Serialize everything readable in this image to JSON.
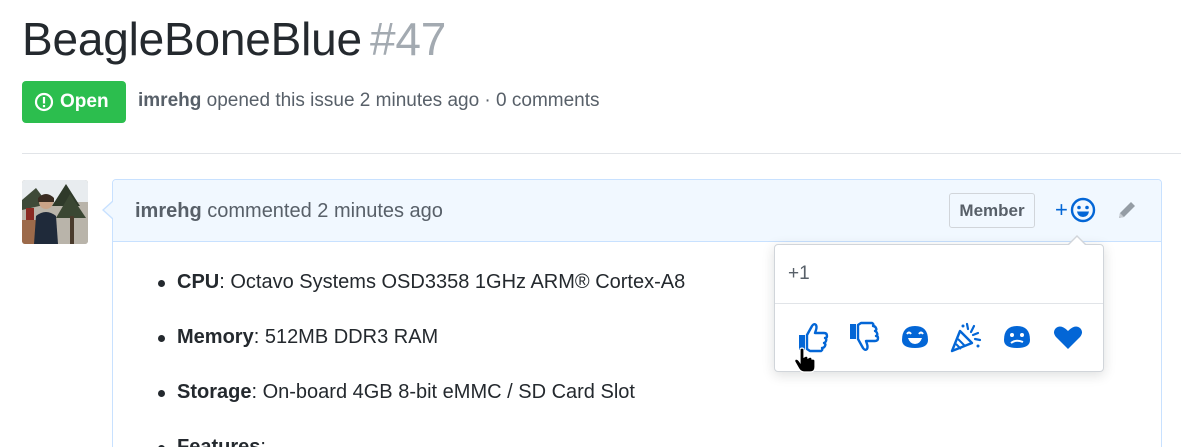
{
  "issue": {
    "title": "BeagleBoneBlue",
    "number": "#47",
    "state": "Open",
    "author": "imrehg",
    "meta_text": " opened this issue 2 minutes ago · 0 comments"
  },
  "comment": {
    "author": "imrehg",
    "meta_text": " commented 2 minutes ago",
    "role_badge": "Member",
    "add_reaction_plus": "+",
    "items": [
      {
        "label": "CPU",
        "text": ": Octavo Systems OSD3358 1GHz ARM® Cortex-A8"
      },
      {
        "label": "Memory",
        "text": ": 512MB DDR3 RAM"
      },
      {
        "label": "Storage",
        "text": ": On-board 4GB 8-bit eMMC / SD Card Slot"
      },
      {
        "label": "Features",
        "text": ":"
      }
    ]
  },
  "reaction_popover": {
    "hover_label": "+1",
    "reactions": [
      "thumbs-up",
      "thumbs-down",
      "laugh",
      "hooray",
      "confused",
      "heart"
    ]
  },
  "colors": {
    "open_green": "#2cbe4e",
    "link_blue": "#0366d6",
    "header_bg": "#f1f8ff",
    "header_border": "#c8e1ff"
  }
}
